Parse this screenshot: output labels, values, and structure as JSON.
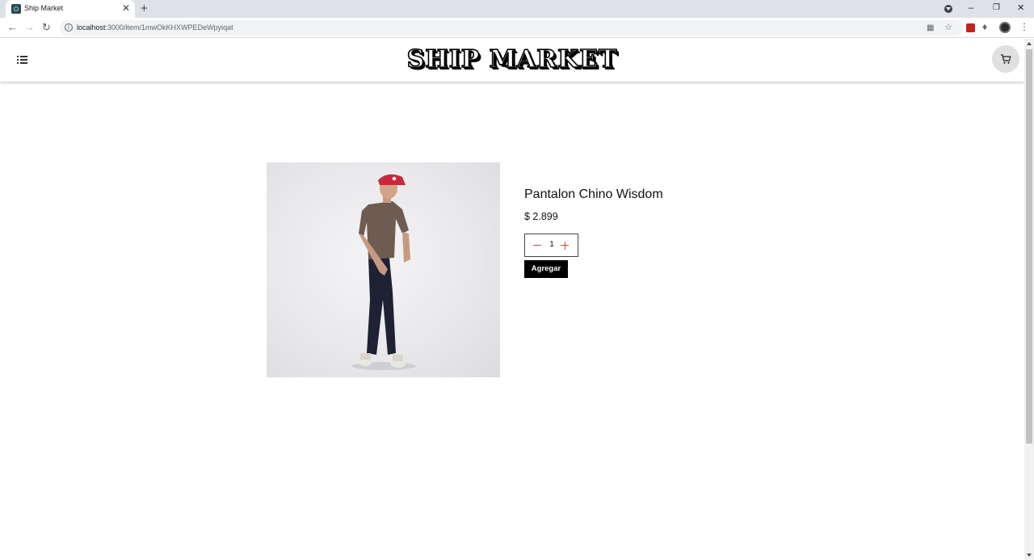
{
  "browser": {
    "tab_title": "Ship Market",
    "tab_close": "✕",
    "new_tab": "+",
    "url_host": "localhost",
    "url_path": ":3000/item/1mwOkKHXWPEDeWpyiqat",
    "window_minimize": "–",
    "window_restore": "❐",
    "window_close": "✕"
  },
  "header": {
    "logo": "SHIP MARKET"
  },
  "product": {
    "name": "Pantalon Chino Wisdom",
    "price": "$ 2.899",
    "quantity": "1",
    "add_label": "Agregar"
  },
  "colors": {
    "logo_fill": "#ffffff",
    "logo_outline": "#000000",
    "add_button_bg": "#000000",
    "stepper_icon": "#b5523a",
    "cart_button_bg": "#e0e0e0"
  },
  "icons": {
    "menu": "list-menu-icon",
    "cart": "shopping-cart-icon",
    "minus": "minus-icon",
    "plus": "plus-icon"
  }
}
